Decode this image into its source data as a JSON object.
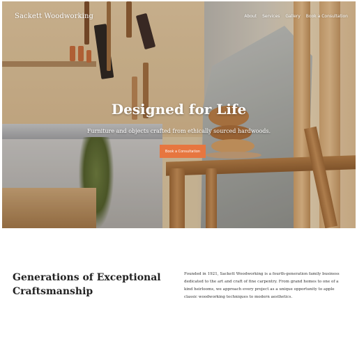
{
  "header": {
    "brand": "Sackett Woodworking",
    "nav": [
      "About",
      "Services",
      "Gallery",
      "Book a Consultation"
    ]
  },
  "hero": {
    "title": "Designed for Life",
    "subtitle": "Furniture and objects crafted from ethically sourced hardwoods.",
    "cta_label": "Book a Consultation",
    "cta_color": "#e7763f"
  },
  "about": {
    "title": "Generations of Exceptional Craftsmanship",
    "body": "Founded in 1921, Sackett Woodworking is a fourth-generation family business dedicated to the art and craft of fine carpentry. From grand homes to one of a kind heirlooms, we approach every project as a unique opportunity to apple classic woodworking techniques to modern aesthetics."
  }
}
